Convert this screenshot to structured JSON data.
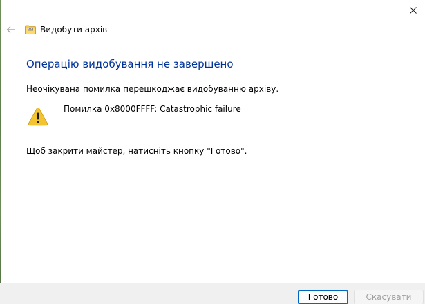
{
  "window": {
    "title": "Видобути архів",
    "close_icon": "close-icon",
    "back_icon": "back-arrow-icon",
    "folder_icon": "zip-folder-icon"
  },
  "content": {
    "heading": "Операцію видобування не завершено",
    "description": "Неочікувана помилка перешкоджає видобуванню архіву.",
    "error_message": "Помилка 0x8000FFFF: Catastrophic failure",
    "instruction": "Щоб закрити майстер, натисніть кнопку \"Готово\".",
    "warning_icon": "warning-icon"
  },
  "footer": {
    "finish_label": "Готово",
    "cancel_label": "Скасувати",
    "cancel_enabled": false
  },
  "colors": {
    "heading": "#003399",
    "accent": "#0067c0",
    "warning_fill": "#f4c430",
    "footer_bg": "#f0f0f0"
  }
}
